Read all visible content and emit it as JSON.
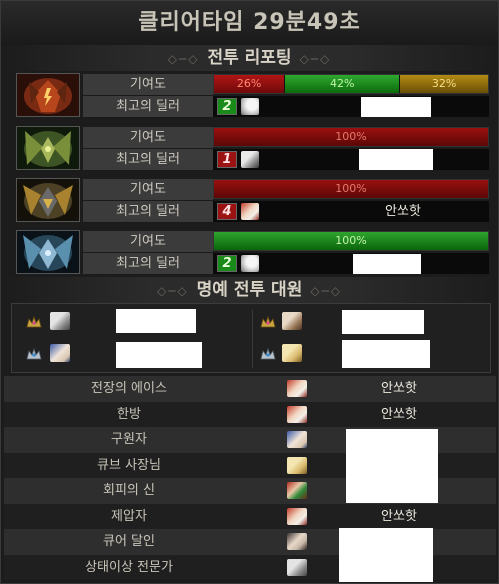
{
  "header": {
    "title": "클리어타임  29분49초"
  },
  "battle_report": {
    "heading": "전투 리포팅",
    "bosses": [
      {
        "icon": "red-boss-icon",
        "contribution_label": "기여도",
        "dealer_label": "최고의 딜러",
        "segments": [
          {
            "label": "26%",
            "value": 26,
            "color": "#b01515"
          },
          {
            "label": "42%",
            "value": 42,
            "color": "#2fa82f"
          },
          {
            "label": "32%",
            "value": 32,
            "color": "#b38a13"
          }
        ],
        "rank": "2",
        "rank_color": "green",
        "avatar": "white-hair-avatar",
        "dealer_name": ""
      },
      {
        "icon": "green-boss-icon",
        "contribution_label": "기여도",
        "dealer_label": "최고의 딜러",
        "segments": [
          {
            "label": "100%",
            "value": 100,
            "color": "#9a1010"
          }
        ],
        "rank": "1",
        "rank_color": "red",
        "avatar": "silver-hair-avatar",
        "dealer_name": ""
      },
      {
        "icon": "gold-boss-icon",
        "contribution_label": "기여도",
        "dealer_label": "최고의 딜러",
        "segments": [
          {
            "label": "100%",
            "value": 100,
            "color": "#9a1010"
          }
        ],
        "rank": "4",
        "rank_color": "red",
        "avatar": "red-fox-avatar",
        "dealer_name": "안쏘핫"
      },
      {
        "icon": "blue-boss-icon",
        "contribution_label": "기여도",
        "dealer_label": "최고의 딜러",
        "segments": [
          {
            "label": "100%",
            "value": 100,
            "color": "#2ea52e"
          }
        ],
        "rank": "2",
        "rank_color": "green",
        "avatar": "white-hair-avatar",
        "dealer_name": ""
      }
    ]
  },
  "honor": {
    "heading": "명예 전투 대원",
    "members": [
      {
        "medal": "gold-medal-icon",
        "avatar": "silver-hair-avatar",
        "name": ""
      },
      {
        "medal": "gold-medal-icon",
        "avatar": "brown-hair-avatar",
        "name": ""
      },
      {
        "medal": "silver-medal-icon",
        "avatar": "blue-hair-avatar",
        "name": ""
      },
      {
        "medal": "silver-medal-icon",
        "avatar": "blonde-avatar",
        "name": ""
      }
    ]
  },
  "awards": [
    {
      "title": "전장의 에이스",
      "avatar": "red-fox-avatar",
      "name": "안쏘핫"
    },
    {
      "title": "한방",
      "avatar": "red-fox-avatar",
      "name": "안쏘핫"
    },
    {
      "title": "구원자",
      "avatar": "blue-hair-avatar",
      "name": ""
    },
    {
      "title": "큐브 사장님",
      "avatar": "blonde-avatar",
      "name": ""
    },
    {
      "title": "회피의 신",
      "avatar": "green-eye-avatar",
      "name": ""
    },
    {
      "title": "제압자",
      "avatar": "red-fox-avatar",
      "name": "안쏘핫"
    },
    {
      "title": "큐어 달인",
      "avatar": "dark-hair-avatar",
      "name": ""
    },
    {
      "title": "상태이상 전문가",
      "avatar": "silver-hair-avatar",
      "name": ""
    }
  ]
}
